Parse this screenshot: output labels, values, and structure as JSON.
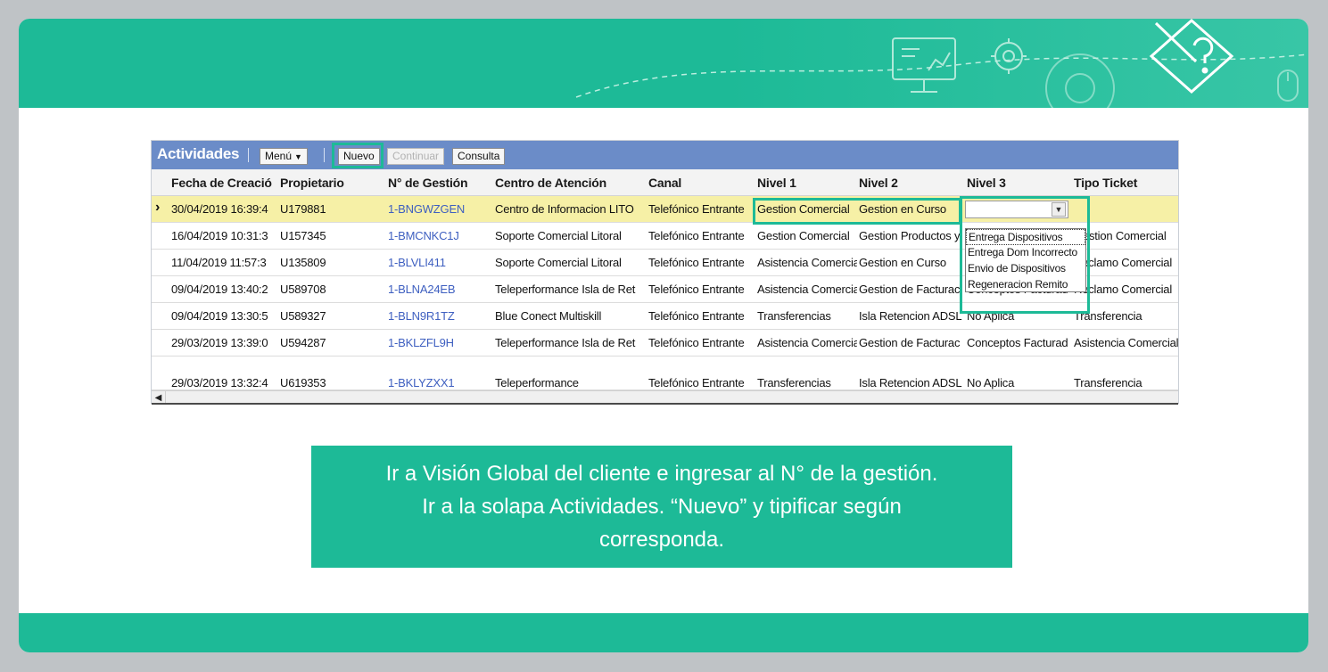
{
  "toolbar": {
    "title": "Actividades",
    "menu_label": "Menú",
    "nuevo_label": "Nuevo",
    "continuar_label": "Continuar",
    "consulta_label": "Consulta"
  },
  "columns": [
    "Fecha de Creació",
    "Propietario",
    "N° de Gestión",
    "Centro de Atención",
    "Canal",
    "Nivel 1",
    "Nivel 2",
    "Nivel 3",
    "Tipo Ticket"
  ],
  "rows": [
    {
      "fecha": "30/04/2019 16:39:4",
      "propietario": "U179881",
      "gestion": "1-BNGWZGEN",
      "centro": "Centro de Informacion LITO",
      "canal": "Telefónico Entrante",
      "nivel1": "Gestion Comercial",
      "nivel2": "Gestion en Curso",
      "nivel3": "",
      "tipo": ""
    },
    {
      "fecha": "16/04/2019 10:31:3",
      "propietario": "U157345",
      "gestion": "1-BMCNKC1J",
      "centro": "Soporte Comercial Litoral",
      "canal": "Telefónico Entrante",
      "nivel1": "Gestion Comercial",
      "nivel2": "Gestion Productos y",
      "nivel3": "",
      "tipo": "Gestion Comercial"
    },
    {
      "fecha": "11/04/2019 11:57:3",
      "propietario": "U135809",
      "gestion": "1-BLVLI411",
      "centro": "Soporte Comercial Litoral",
      "canal": "Telefónico Entrante",
      "nivel1": "Asistencia Comercia",
      "nivel2": "Gestion en Curso",
      "nivel3": "",
      "tipo": "Reclamo Comercial"
    },
    {
      "fecha": "09/04/2019 13:40:2",
      "propietario": "U589708",
      "gestion": "1-BLNA24EB",
      "centro": "Teleperformance Isla de Ret",
      "canal": "Telefónico Entrante",
      "nivel1": "Asistencia Comercia",
      "nivel2": "Gestion de Facturac",
      "nivel3": "Conceptos Facturad",
      "tipo": "Reclamo Comercial"
    },
    {
      "fecha": "09/04/2019 13:30:5",
      "propietario": "U589327",
      "gestion": "1-BLN9R1TZ",
      "centro": "Blue Conect Multiskill",
      "canal": "Telefónico Entrante",
      "nivel1": "Transferencias",
      "nivel2": "Isla Retencion ADSL",
      "nivel3": "No Aplica",
      "tipo": "Transferencia"
    },
    {
      "fecha": "29/03/2019 13:39:0",
      "propietario": "U594287",
      "gestion": "1-BKLZFL9H",
      "centro": "Teleperformance Isla de Ret",
      "canal": "Telefónico Entrante",
      "nivel1": "Asistencia Comercia",
      "nivel2": "Gestion de Facturac",
      "nivel3": "Conceptos Facturad",
      "tipo": "Asistencia Comercial"
    },
    {
      "fecha": "29/03/2019 13:32:4",
      "propietario": "U619353",
      "gestion": "1-BKLYZXX1",
      "centro": "Teleperformance",
      "canal": "Telefónico Entrante",
      "nivel1": "Transferencias",
      "nivel2": "Isla Retencion ADSL",
      "nivel3": "No Aplica",
      "tipo": "Transferencia"
    }
  ],
  "nivel3_options": [
    "Entrega Dispositivos",
    "Entrega Dom Incorrecto",
    "Envio de Dispositivos",
    "Regeneracion Remito"
  ],
  "instruction": {
    "line1": "Ir a Visión Global del cliente e ingresar al N° de la gestión.",
    "line2": "Ir a la solapa Actividades. “Nuevo” y tipificar según",
    "line3": "corresponda."
  },
  "colors": {
    "accent": "#1dba97",
    "toolbar": "#6b8cc8",
    "selected_row": "#f6f0a6",
    "link": "#3e5fc0"
  },
  "icons": [
    "presentation-board-icon",
    "gear-icon",
    "pencil-question-icon",
    "mouse-icon"
  ]
}
